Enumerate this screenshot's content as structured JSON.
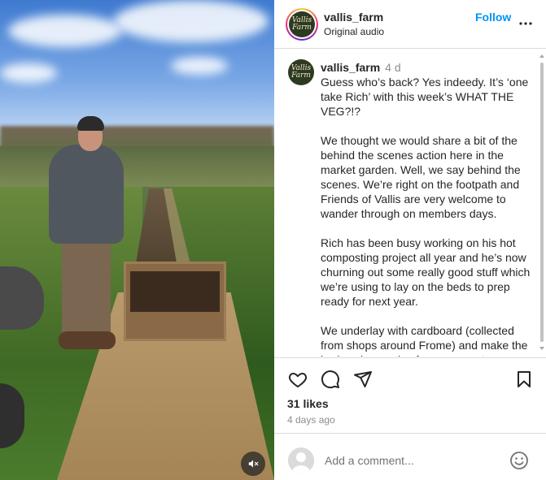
{
  "post": {
    "username": "vallis_farm",
    "audio": "Original audio",
    "follow_label": "Follow",
    "avatar_text": "Vallis Farm"
  },
  "caption": {
    "username": "vallis_farm",
    "time": "4 d",
    "text": "Guess who’s back? Yes indeedy. It’s ‘one take Rich’ with this week’s WHAT THE VEG?!?\n\nWe thought we would share a bit of the behind the scenes action here in the market garden. Well, we say behind the scenes. We’re right on the footpath and Friends of Vallis are very welcome to wander through on members days.\n\nRich has been busy working on his hot composting project all year and he’s now churning out some really good stuff which we’re using to lay on the beds to prep ready for next year.\n\nWe underlay with cardboard (collected from shops around Frome) and make the beds using a mix of our compost"
  },
  "actions": {
    "likes": "31 likes",
    "date": "4 days ago"
  },
  "comment_box": {
    "placeholder": "Add a comment..."
  },
  "icons": {
    "more": "more-options-icon",
    "like": "heart-icon",
    "comment": "comment-icon",
    "share": "share-icon",
    "save": "bookmark-icon",
    "emoji": "emoji-icon",
    "mute": "muted-speaker-icon"
  },
  "colors": {
    "link_blue": "#0095f6",
    "text": "#262626",
    "secondary": "#8e8e8e",
    "border": "#dbdbdb"
  }
}
